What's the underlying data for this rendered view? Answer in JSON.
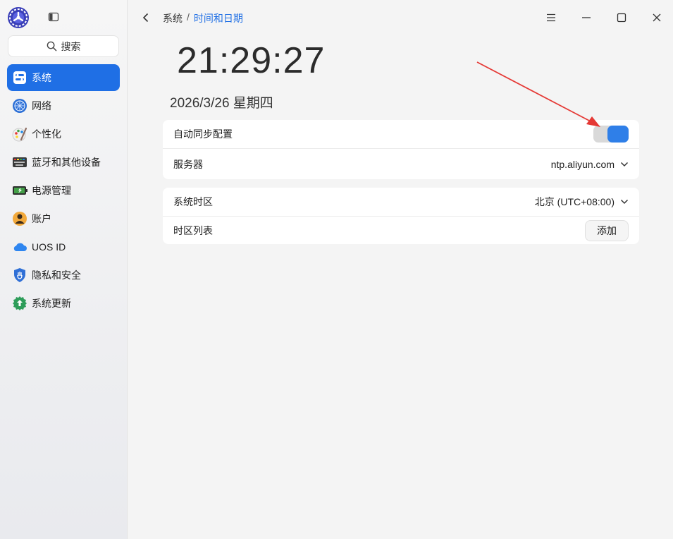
{
  "sidebar": {
    "search_label": "搜索",
    "items": [
      {
        "label": "系统",
        "icon": "system-icon",
        "active": true
      },
      {
        "label": "网络",
        "icon": "network-icon"
      },
      {
        "label": "个性化",
        "icon": "personalization-icon"
      },
      {
        "label": "蓝牙和其他设备",
        "icon": "bluetooth-devices-icon"
      },
      {
        "label": "电源管理",
        "icon": "power-icon"
      },
      {
        "label": "账户",
        "icon": "account-icon"
      },
      {
        "label": "UOS ID",
        "icon": "cloud-icon"
      },
      {
        "label": "隐私和安全",
        "icon": "privacy-shield-icon"
      },
      {
        "label": "系统更新",
        "icon": "update-icon"
      }
    ]
  },
  "header": {
    "breadcrumb_parent": "系统",
    "breadcrumb_sep": "/",
    "breadcrumb_current": "时间和日期"
  },
  "clock": {
    "time": "21:29:27",
    "date": "2026/3/26 星期四"
  },
  "sync_card": {
    "auto_sync_label": "自动同步配置",
    "auto_sync_on": true,
    "server_label": "服务器",
    "server_value": "ntp.aliyun.com"
  },
  "timezone_card": {
    "timezone_label": "系统时区",
    "timezone_value": "北京 (UTC+08:00)",
    "timezone_list_label": "时区列表",
    "add_label": "添加"
  },
  "colors": {
    "accent": "#1f6fe5",
    "annotation_arrow": "#e53935"
  }
}
